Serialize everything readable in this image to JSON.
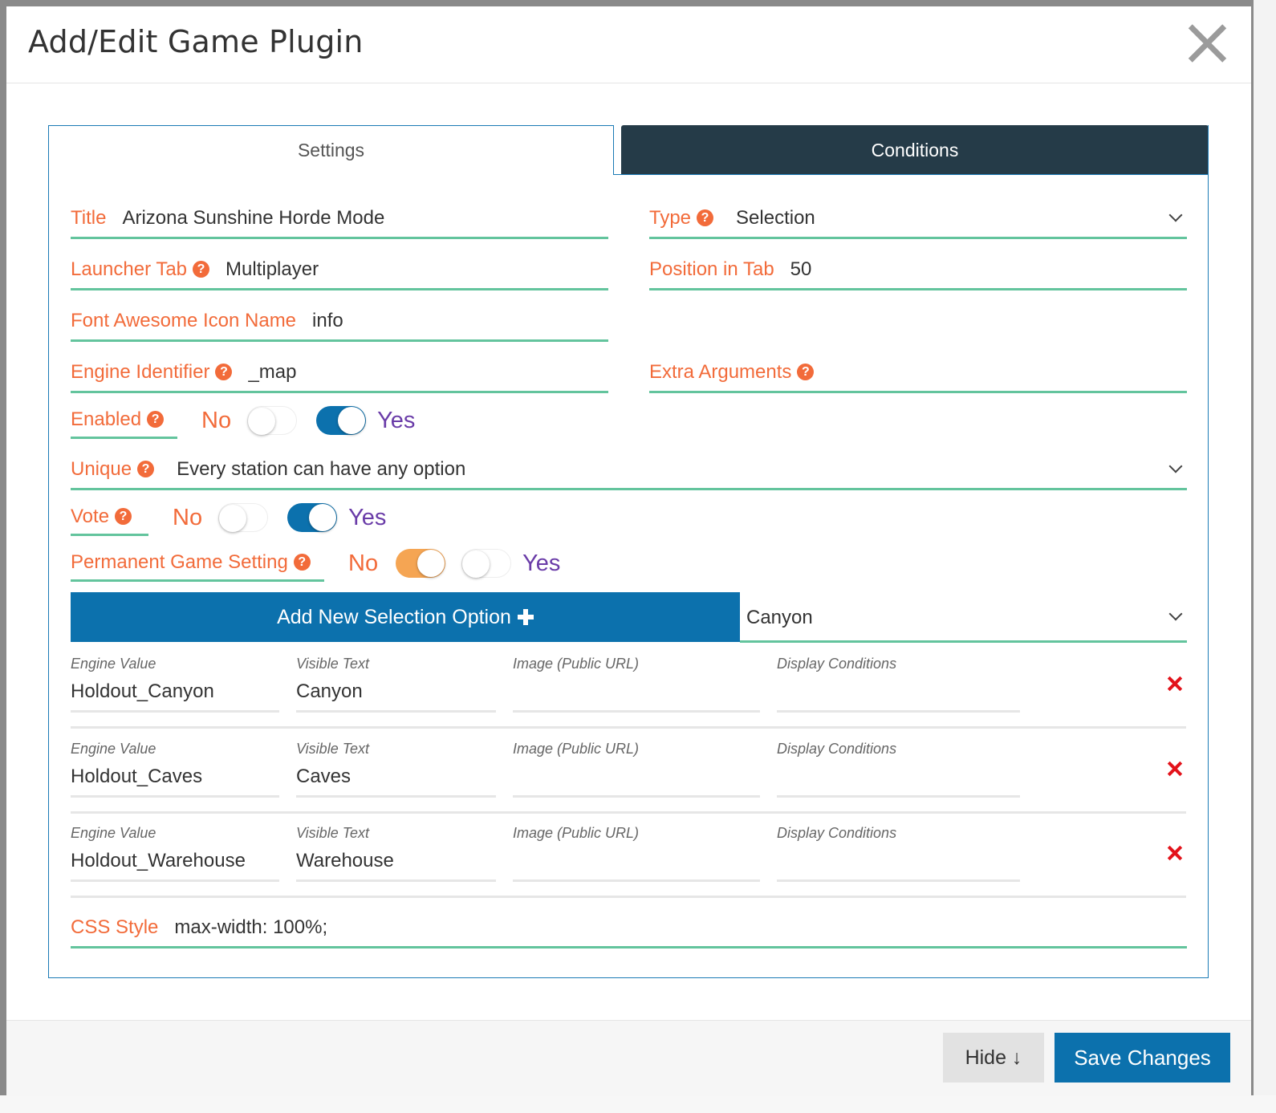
{
  "modal": {
    "title": "Add/Edit Game Plugin"
  },
  "tabs": {
    "settings": "Settings",
    "conditions": "Conditions"
  },
  "fields": {
    "title": {
      "label": "Title",
      "value": "Arizona Sunshine Horde Mode"
    },
    "type": {
      "label": "Type",
      "value": "Selection"
    },
    "launcher_tab": {
      "label": "Launcher Tab",
      "value": "Multiplayer"
    },
    "position_in_tab": {
      "label": "Position in Tab",
      "value": "50"
    },
    "font_awesome_icon": {
      "label": "Font Awesome Icon Name",
      "value": "info"
    },
    "engine_identifier": {
      "label": "Engine Identifier",
      "value": "_map"
    },
    "extra_arguments": {
      "label": "Extra Arguments",
      "value": ""
    },
    "unique": {
      "label": "Unique",
      "value": "Every station can have any option"
    },
    "css_style": {
      "label": "CSS Style",
      "value": "max-width: 100%;"
    }
  },
  "toggles": {
    "enabled": {
      "label": "Enabled",
      "no": "No",
      "yes": "Yes",
      "value": "Yes"
    },
    "vote": {
      "label": "Vote",
      "no": "No",
      "yes": "Yes",
      "value": "Yes"
    },
    "permanent": {
      "label": "Permanent Game Setting",
      "no": "No",
      "yes": "Yes",
      "value": "No"
    }
  },
  "selection": {
    "add_button": "Add New Selection Option",
    "default_option": "Canyon",
    "headers": {
      "engine_value": "Engine Value",
      "visible_text": "Visible Text",
      "image": "Image (Public URL)",
      "display_conditions": "Display Conditions"
    },
    "options": [
      {
        "engine_value": "Holdout_Canyon",
        "visible_text": "Canyon",
        "image": "",
        "display_conditions": ""
      },
      {
        "engine_value": "Holdout_Caves",
        "visible_text": "Caves",
        "image": "",
        "display_conditions": ""
      },
      {
        "engine_value": "Holdout_Warehouse",
        "visible_text": "Warehouse",
        "image": "",
        "display_conditions": ""
      }
    ]
  },
  "footer": {
    "hide": "Hide ↓",
    "save": "Save Changes"
  },
  "colors": {
    "label": "#f26b3a",
    "underline": "#63c49d",
    "primary": "#0c71ad",
    "tab_dark": "#253b48",
    "yes": "#6a3ca8",
    "toggle_orange": "#f5a553",
    "delete": "#e3131b"
  },
  "icons": {
    "help": "question-circle-icon",
    "delete": "times-icon",
    "add": "plus-icon",
    "close": "close-icon",
    "dropdown": "chevron-down-icon"
  }
}
